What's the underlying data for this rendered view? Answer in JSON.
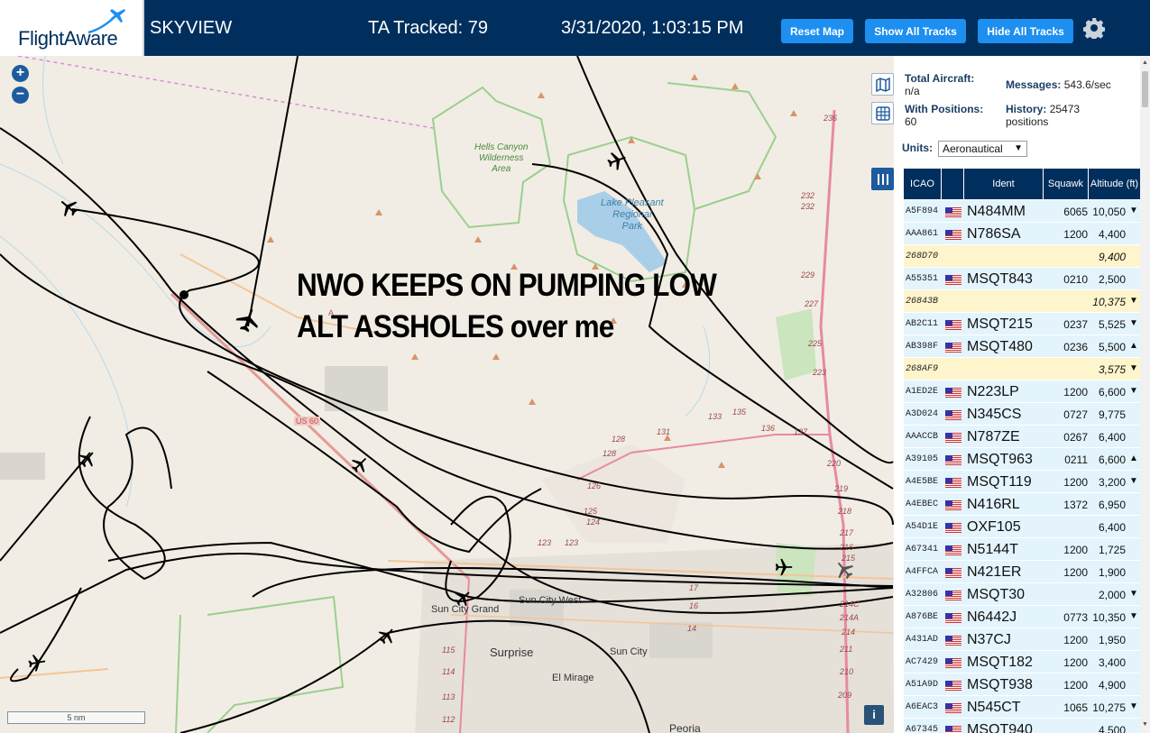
{
  "header": {
    "logo_text": "FlightAware",
    "app_name": "SKYVIEW",
    "tracked": "TA Tracked: 79",
    "datetime": "3/31/2020, 1:03:15 PM",
    "reset_label": "Reset Map",
    "show_label": "Show All Tracks",
    "hide_label": "Hide All Tracks",
    "brand_color": "#002f5d",
    "button_color": "#1d8ff0"
  },
  "map": {
    "overlay_text": "NWO KEEPS ON PUMPING LOW\nALT ASSHOLES over me",
    "scale_label": "5 nm",
    "info_label": "i",
    "zoom_in_label": "+",
    "zoom_out_label": "−",
    "labels": {
      "hells_canyon": "Hells Canyon\nWilderness\nArea",
      "lake_pleasant": "Lake Pleasant\nRegional\nPark",
      "sun_city_west": "Sun City West",
      "sun_city_grand": "Sun City Grand",
      "surprise": "Surprise",
      "sun_city": "Sun City",
      "el_mirage": "El Mirage",
      "peoria": "Peoria",
      "us60": "US 60",
      "a": "A"
    },
    "route_numbers": [
      "236",
      "232",
      "232",
      "229",
      "227",
      "225",
      "223",
      "220",
      "219",
      "218",
      "217",
      "216",
      "215",
      "214C",
      "214A",
      "214",
      "211",
      "210",
      "209",
      "137",
      "136",
      "135",
      "133",
      "131",
      "128",
      "128",
      "126",
      "125",
      "124",
      "123",
      "123",
      "115",
      "114",
      "113",
      "112",
      "17",
      "16",
      "14"
    ]
  },
  "panel": {
    "total_aircraft_label": "Total Aircraft:",
    "total_aircraft_value": "n/a",
    "with_positions_label": "With Positions:",
    "with_positions_value": "60",
    "messages_label": "Messages:",
    "messages_value": "543.6/sec",
    "history_label": "History:",
    "history_value": "25473",
    "history_unit": "positions",
    "units_label": "Units:",
    "units_value": "Aeronautical",
    "columns": [
      "ICAO",
      "",
      "Ident",
      "Squawk",
      "Altitude (ft)"
    ],
    "rows": [
      {
        "icao": "A5F894",
        "flag": true,
        "ident": "N484MM",
        "squawk": "6065",
        "alt": "10,050",
        "trend": "▼",
        "style": "blue"
      },
      {
        "icao": "AAA861",
        "flag": true,
        "ident": "N786SA",
        "squawk": "1200",
        "alt": "4,400",
        "trend": "",
        "style": "blue"
      },
      {
        "icao": "268D70",
        "flag": false,
        "ident": "",
        "squawk": "",
        "alt": "9,400",
        "trend": "",
        "style": "yellow"
      },
      {
        "icao": "A55351",
        "flag": true,
        "ident": "MSQT843",
        "squawk": "0210",
        "alt": "2,500",
        "trend": "",
        "style": "blue"
      },
      {
        "icao": "26843B",
        "flag": false,
        "ident": "",
        "squawk": "",
        "alt": "10,375",
        "trend": "▼",
        "style": "yellow"
      },
      {
        "icao": "AB2C11",
        "flag": true,
        "ident": "MSQT215",
        "squawk": "0237",
        "alt": "5,525",
        "trend": "▼",
        "style": "blue"
      },
      {
        "icao": "AB398F",
        "flag": true,
        "ident": "MSQT480",
        "squawk": "0236",
        "alt": "5,500",
        "trend": "▲",
        "style": "blue"
      },
      {
        "icao": "268AF9",
        "flag": false,
        "ident": "",
        "squawk": "",
        "alt": "3,575",
        "trend": "▼",
        "style": "yellow"
      },
      {
        "icao": "A1ED2E",
        "flag": true,
        "ident": "N223LP",
        "squawk": "1200",
        "alt": "6,600",
        "trend": "▼",
        "style": "blue"
      },
      {
        "icao": "A3D024",
        "flag": true,
        "ident": "N345CS",
        "squawk": "0727",
        "alt": "9,775",
        "trend": "",
        "style": "blue"
      },
      {
        "icao": "AAACCB",
        "flag": true,
        "ident": "N787ZE",
        "squawk": "0267",
        "alt": "6,400",
        "trend": "",
        "style": "blue"
      },
      {
        "icao": "A39105",
        "flag": true,
        "ident": "MSQT963",
        "squawk": "0211",
        "alt": "6,600",
        "trend": "▲",
        "style": "blue"
      },
      {
        "icao": "A4E5BE",
        "flag": true,
        "ident": "MSQT119",
        "squawk": "1200",
        "alt": "3,200",
        "trend": "▼",
        "style": "blue"
      },
      {
        "icao": "A4EBEC",
        "flag": true,
        "ident": "N416RL",
        "squawk": "1372",
        "alt": "6,950",
        "trend": "",
        "style": "blue"
      },
      {
        "icao": "A54D1E",
        "flag": true,
        "ident": "OXF105",
        "squawk": "",
        "alt": "6,400",
        "trend": "",
        "style": "blue"
      },
      {
        "icao": "A67341",
        "flag": true,
        "ident": "N5144T",
        "squawk": "1200",
        "alt": "1,725",
        "trend": "",
        "style": "blue"
      },
      {
        "icao": "A4FFCA",
        "flag": true,
        "ident": "N421ER",
        "squawk": "1200",
        "alt": "1,900",
        "trend": "",
        "style": "blue"
      },
      {
        "icao": "A32806",
        "flag": true,
        "ident": "MSQT30",
        "squawk": "",
        "alt": "2,000",
        "trend": "▼",
        "style": "blue"
      },
      {
        "icao": "A876BE",
        "flag": true,
        "ident": "N6442J",
        "squawk": "0773",
        "alt": "10,350",
        "trend": "▼",
        "style": "blue"
      },
      {
        "icao": "A431AD",
        "flag": true,
        "ident": "N37CJ",
        "squawk": "1200",
        "alt": "1,950",
        "trend": "",
        "style": "blue"
      },
      {
        "icao": "AC7429",
        "flag": true,
        "ident": "MSQT182",
        "squawk": "1200",
        "alt": "3,400",
        "trend": "",
        "style": "blue"
      },
      {
        "icao": "A51A9D",
        "flag": true,
        "ident": "MSQT938",
        "squawk": "1200",
        "alt": "4,900",
        "trend": "",
        "style": "blue"
      },
      {
        "icao": "A6EAC3",
        "flag": true,
        "ident": "N545CT",
        "squawk": "1065",
        "alt": "10,275",
        "trend": "▼",
        "style": "blue"
      },
      {
        "icao": "A67345",
        "flag": true,
        "ident": "MSQT940",
        "squawk": "",
        "alt": "4,500",
        "trend": "",
        "style": "blue"
      }
    ]
  }
}
